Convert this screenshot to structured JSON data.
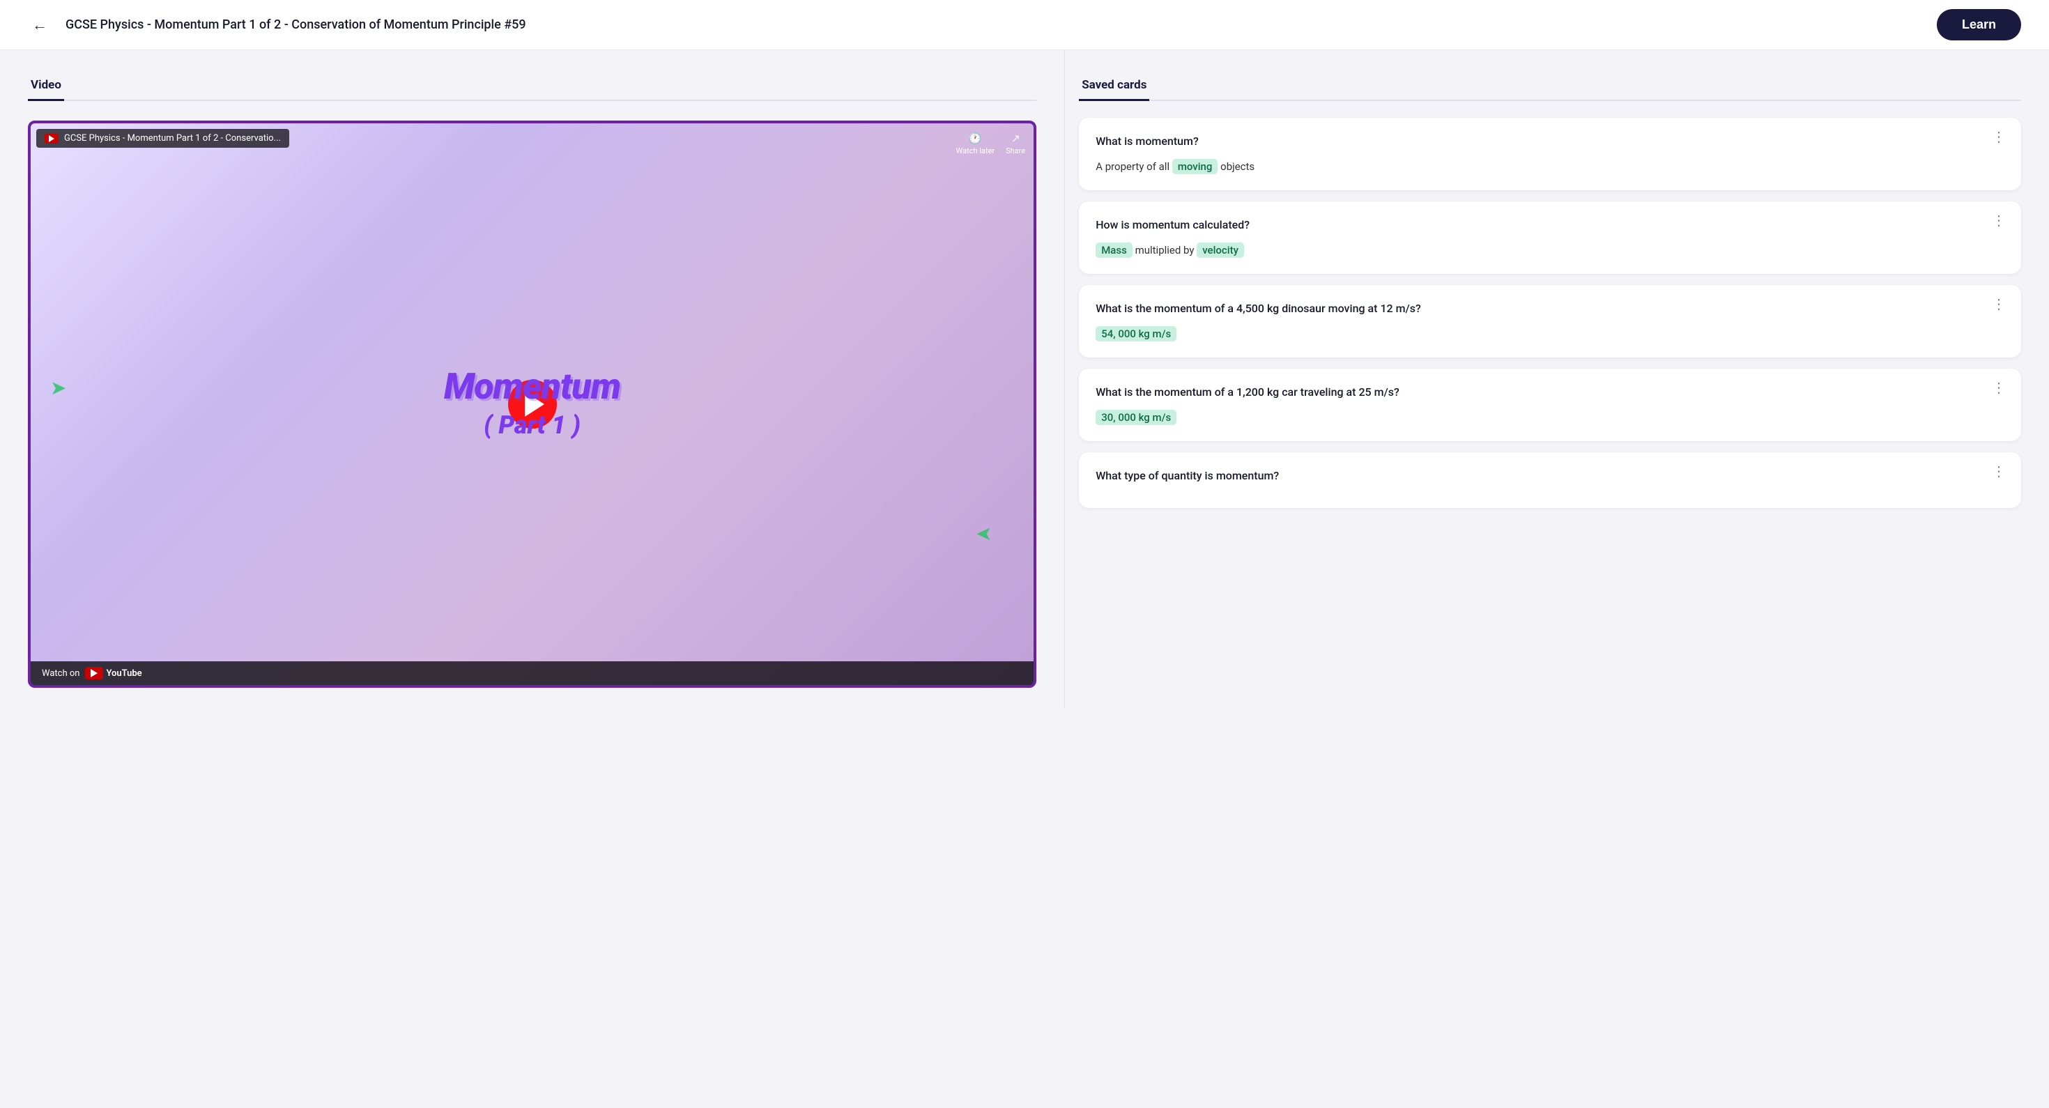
{
  "header": {
    "title": "GCSE Physics - Momentum Part 1 of 2 - Conservation of Momentum Principle #59",
    "learn_btn": "Learn",
    "back_icon": "←"
  },
  "left_panel": {
    "tab_label": "Video",
    "video": {
      "title_overlay": "GCSE Physics - Momentum Part 1 of 2 - Conservatio...",
      "watch_later": "Watch later",
      "share": "Share",
      "watch_on": "Watch on",
      "youtube_label": "YouTube",
      "momentum_text": "Momentum",
      "part_text": "( Part 1 )"
    }
  },
  "right_panel": {
    "tab_label": "Saved cards",
    "cards": [
      {
        "question": "What is momentum?",
        "answer_parts": [
          {
            "text": "A property of all ",
            "type": "normal"
          },
          {
            "text": "moving",
            "type": "highlight"
          },
          {
            "text": " objects",
            "type": "normal"
          }
        ]
      },
      {
        "question": "How is momentum calculated?",
        "answer_parts": [
          {
            "text": "Mass",
            "type": "highlight"
          },
          {
            "text": " multiplied by ",
            "type": "normal"
          },
          {
            "text": "velocity",
            "type": "highlight"
          }
        ]
      },
      {
        "question": "What is the momentum of a 4,500 kg dinosaur moving at 12 m/s?",
        "answer_parts": [
          {
            "text": "54, 000 kg m/s",
            "type": "highlight"
          }
        ]
      },
      {
        "question": "What is the momentum of a 1,200 kg car traveling at 25 m/s?",
        "answer_parts": [
          {
            "text": "30, 000 kg m/s",
            "type": "highlight"
          }
        ]
      },
      {
        "question": "What type of quantity is momentum?",
        "answer_parts": []
      }
    ]
  }
}
